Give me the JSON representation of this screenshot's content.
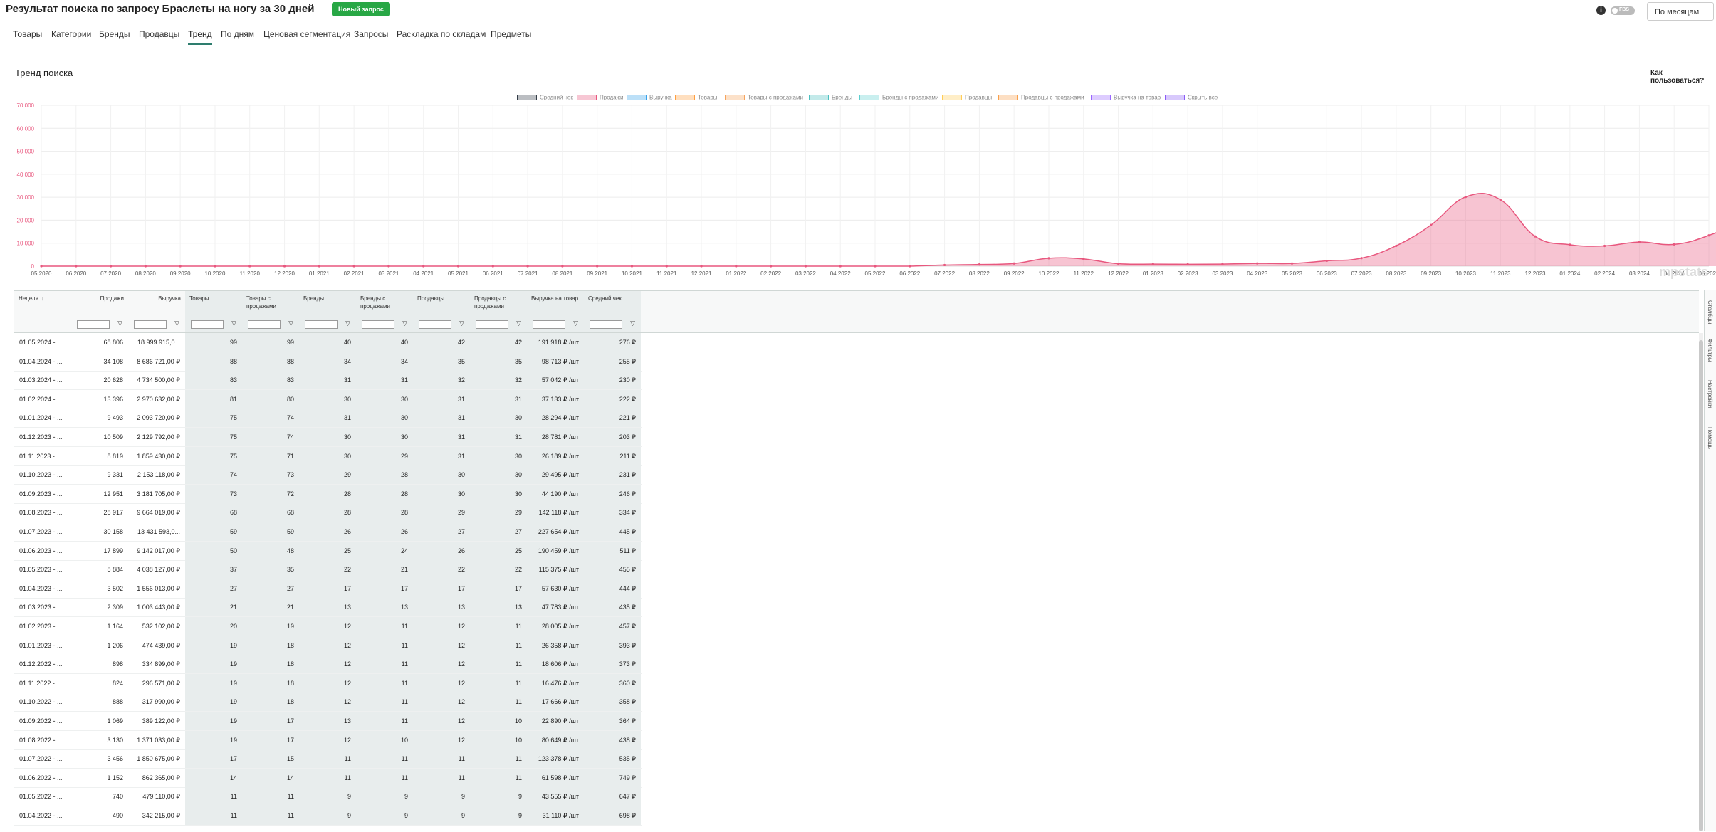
{
  "header": {
    "title": "Результат поиска по запросу Браслеты на ногу за 30 дней",
    "new_request": "Новый запрос",
    "fbs": "FBS",
    "period": "По месяцам"
  },
  "tabs": [
    {
      "label": "Товары"
    },
    {
      "label": "Категории"
    },
    {
      "label": "Бренды"
    },
    {
      "label": "Продавцы"
    },
    {
      "label": "Тренд",
      "active": true
    },
    {
      "label": "По дням"
    },
    {
      "label": "Ценовая сегментация"
    },
    {
      "label": "Запросы"
    },
    {
      "label": "Раскладка по складам"
    },
    {
      "label": "Предметы"
    }
  ],
  "section": {
    "title": "Тренд поиска",
    "howto": "Как пользоваться?"
  },
  "legend": [
    {
      "label": "Средний чек",
      "color": "#333d47",
      "hidden": true
    },
    {
      "label": "Продажи",
      "color": "#e8577e",
      "hidden": false
    },
    {
      "label": "Выручка",
      "color": "#36a2eb",
      "hidden": true
    },
    {
      "label": "Товары",
      "color": "#ff9f40",
      "hidden": true
    },
    {
      "label": "Товары с продажами",
      "color": "#f5a45e",
      "hidden": true
    },
    {
      "label": "Бренды",
      "color": "#4bc0c0",
      "hidden": true
    },
    {
      "label": "Бренды с продажами",
      "color": "#5ccfcf",
      "hidden": true
    },
    {
      "label": "Продавцы",
      "color": "#ffcd56",
      "hidden": true
    },
    {
      "label": "Продавцы с продажами",
      "color": "#f9a04c",
      "hidden": true
    },
    {
      "label": "Выручка на товар",
      "color": "#9966ff",
      "hidden": true
    },
    {
      "label": "Скрыть все",
      "color": "#8b5cf6",
      "hidden": false
    }
  ],
  "watermark": "mpstats",
  "chart_data": {
    "type": "area",
    "series": [
      {
        "name": "Продажи",
        "color": "#e8577e"
      }
    ],
    "x": [
      "05.2020",
      "06.2020",
      "07.2020",
      "08.2020",
      "09.2020",
      "10.2020",
      "11.2020",
      "12.2020",
      "01.2021",
      "02.2021",
      "03.2021",
      "04.2021",
      "05.2021",
      "06.2021",
      "07.2021",
      "08.2021",
      "09.2021",
      "10.2021",
      "11.2021",
      "12.2021",
      "01.2022",
      "02.2022",
      "03.2022",
      "04.2022",
      "05.2022",
      "06.2022",
      "07.2022",
      "08.2022",
      "09.2022",
      "10.2022",
      "11.2022",
      "12.2022",
      "01.2023",
      "02.2023",
      "03.2023",
      "04.2023",
      "05.2023",
      "06.2023",
      "07.2023",
      "08.2023",
      "09.2023",
      "10.2023",
      "11.2023",
      "12.2023",
      "01.2024",
      "02.2024",
      "03.2024",
      "04.2024",
      "05.2024"
    ],
    "values": [
      0,
      0,
      0,
      0,
      0,
      0,
      0,
      0,
      0,
      0,
      0,
      0,
      0,
      0,
      0,
      0,
      0,
      0,
      0,
      0,
      0,
      0,
      0,
      0,
      0,
      0,
      490,
      740,
      1152,
      3456,
      3130,
      1069,
      888,
      824,
      898,
      1206,
      1164,
      2309,
      3502,
      8884,
      17899,
      30158,
      28917,
      12951,
      9331,
      8819,
      10509,
      9493,
      13396,
      20628,
      34108,
      68806
    ],
    "ylim": [
      0,
      70000
    ],
    "yticks": [
      "0",
      "10 000",
      "20 000",
      "30 000",
      "40 000",
      "50 000",
      "60 000",
      "70 000"
    ],
    "grid": true
  },
  "table": {
    "columns": [
      {
        "label": "Неделя",
        "sort": "↓"
      },
      {
        "label": "Продажи"
      },
      {
        "label": "Выручка"
      },
      {
        "label": "Товары"
      },
      {
        "label": "Товары с продажами"
      },
      {
        "label": "Бренды"
      },
      {
        "label": "Бренды с продажами"
      },
      {
        "label": "Продавцы"
      },
      {
        "label": "Продавцы с продажами"
      },
      {
        "label": "Выручка на товар"
      },
      {
        "label": "Средний чек"
      }
    ],
    "rows": [
      [
        "01.05.2024 - ...",
        "68 806",
        "18 999 915,0...",
        "99",
        "99",
        "40",
        "40",
        "42",
        "42",
        "191 918 ₽ /шт",
        "276 ₽"
      ],
      [
        "01.04.2024 - ...",
        "34 108",
        "8 686 721,00 ₽",
        "88",
        "88",
        "34",
        "34",
        "35",
        "35",
        "98 713 ₽ /шт",
        "255 ₽"
      ],
      [
        "01.03.2024 - ...",
        "20 628",
        "4 734 500,00 ₽",
        "83",
        "83",
        "31",
        "31",
        "32",
        "32",
        "57 042 ₽ /шт",
        "230 ₽"
      ],
      [
        "01.02.2024 - ...",
        "13 396",
        "2 970 632,00 ₽",
        "81",
        "80",
        "30",
        "30",
        "31",
        "31",
        "37 133 ₽ /шт",
        "222 ₽"
      ],
      [
        "01.01.2024 - ...",
        "9 493",
        "2 093 720,00 ₽",
        "75",
        "74",
        "31",
        "30",
        "31",
        "30",
        "28 294 ₽ /шт",
        "221 ₽"
      ],
      [
        "01.12.2023 - ...",
        "10 509",
        "2 129 792,00 ₽",
        "75",
        "74",
        "30",
        "30",
        "31",
        "31",
        "28 781 ₽ /шт",
        "203 ₽"
      ],
      [
        "01.11.2023 - ...",
        "8 819",
        "1 859 430,00 ₽",
        "75",
        "71",
        "30",
        "29",
        "31",
        "30",
        "26 189 ₽ /шт",
        "211 ₽"
      ],
      [
        "01.10.2023 - ...",
        "9 331",
        "2 153 118,00 ₽",
        "74",
        "73",
        "29",
        "28",
        "30",
        "30",
        "29 495 ₽ /шт",
        "231 ₽"
      ],
      [
        "01.09.2023 - ...",
        "12 951",
        "3 181 705,00 ₽",
        "73",
        "72",
        "28",
        "28",
        "30",
        "30",
        "44 190 ₽ /шт",
        "246 ₽"
      ],
      [
        "01.08.2023 - ...",
        "28 917",
        "9 664 019,00 ₽",
        "68",
        "68",
        "28",
        "28",
        "29",
        "29",
        "142 118 ₽ /шт",
        "334 ₽"
      ],
      [
        "01.07.2023 - ...",
        "30 158",
        "13 431 593,0...",
        "59",
        "59",
        "26",
        "26",
        "27",
        "27",
        "227 654 ₽ /шт",
        "445 ₽"
      ],
      [
        "01.06.2023 - ...",
        "17 899",
        "9 142 017,00 ₽",
        "50",
        "48",
        "25",
        "24",
        "26",
        "25",
        "190 459 ₽ /шт",
        "511 ₽"
      ],
      [
        "01.05.2023 - ...",
        "8 884",
        "4 038 127,00 ₽",
        "37",
        "35",
        "22",
        "21",
        "22",
        "22",
        "115 375 ₽ /шт",
        "455 ₽"
      ],
      [
        "01.04.2023 - ...",
        "3 502",
        "1 556 013,00 ₽",
        "27",
        "27",
        "17",
        "17",
        "17",
        "17",
        "57 630 ₽ /шт",
        "444 ₽"
      ],
      [
        "01.03.2023 - ...",
        "2 309",
        "1 003 443,00 ₽",
        "21",
        "21",
        "13",
        "13",
        "13",
        "13",
        "47 783 ₽ /шт",
        "435 ₽"
      ],
      [
        "01.02.2023 - ...",
        "1 164",
        "532 102,00 ₽",
        "20",
        "19",
        "12",
        "11",
        "12",
        "11",
        "28 005 ₽ /шт",
        "457 ₽"
      ],
      [
        "01.01.2023 - ...",
        "1 206",
        "474 439,00 ₽",
        "19",
        "18",
        "12",
        "11",
        "12",
        "11",
        "26 358 ₽ /шт",
        "393 ₽"
      ],
      [
        "01.12.2022 - ...",
        "898",
        "334 899,00 ₽",
        "19",
        "18",
        "12",
        "11",
        "12",
        "11",
        "18 606 ₽ /шт",
        "373 ₽"
      ],
      [
        "01.11.2022 - ...",
        "824",
        "296 571,00 ₽",
        "19",
        "18",
        "12",
        "11",
        "12",
        "11",
        "16 476 ₽ /шт",
        "360 ₽"
      ],
      [
        "01.10.2022 - ...",
        "888",
        "317 990,00 ₽",
        "19",
        "18",
        "12",
        "11",
        "12",
        "11",
        "17 666 ₽ /шт",
        "358 ₽"
      ],
      [
        "01.09.2022 - ...",
        "1 069",
        "389 122,00 ₽",
        "19",
        "17",
        "13",
        "11",
        "12",
        "10",
        "22 890 ₽ /шт",
        "364 ₽"
      ],
      [
        "01.08.2022 - ...",
        "3 130",
        "1 371 033,00 ₽",
        "19",
        "17",
        "12",
        "10",
        "12",
        "10",
        "80 649 ₽ /шт",
        "438 ₽"
      ],
      [
        "01.07.2022 - ...",
        "3 456",
        "1 850 675,00 ₽",
        "17",
        "15",
        "11",
        "11",
        "11",
        "11",
        "123 378 ₽ /шт",
        "535 ₽"
      ],
      [
        "01.06.2022 - ...",
        "1 152",
        "862 365,00 ₽",
        "14",
        "14",
        "11",
        "11",
        "11",
        "11",
        "61 598 ₽ /шт",
        "749 ₽"
      ],
      [
        "01.05.2022 - ...",
        "740",
        "479 110,00 ₽",
        "11",
        "11",
        "9",
        "9",
        "9",
        "9",
        "43 555 ₽ /шт",
        "647 ₽"
      ],
      [
        "01.04.2022 - ...",
        "490",
        "342 215,00 ₽",
        "11",
        "11",
        "9",
        "9",
        "9",
        "9",
        "31 110 ₽ /шт",
        "698 ₽"
      ]
    ]
  },
  "side_tabs": [
    "Столбцы",
    "Фильтры",
    "Настройки",
    "Помощь"
  ]
}
